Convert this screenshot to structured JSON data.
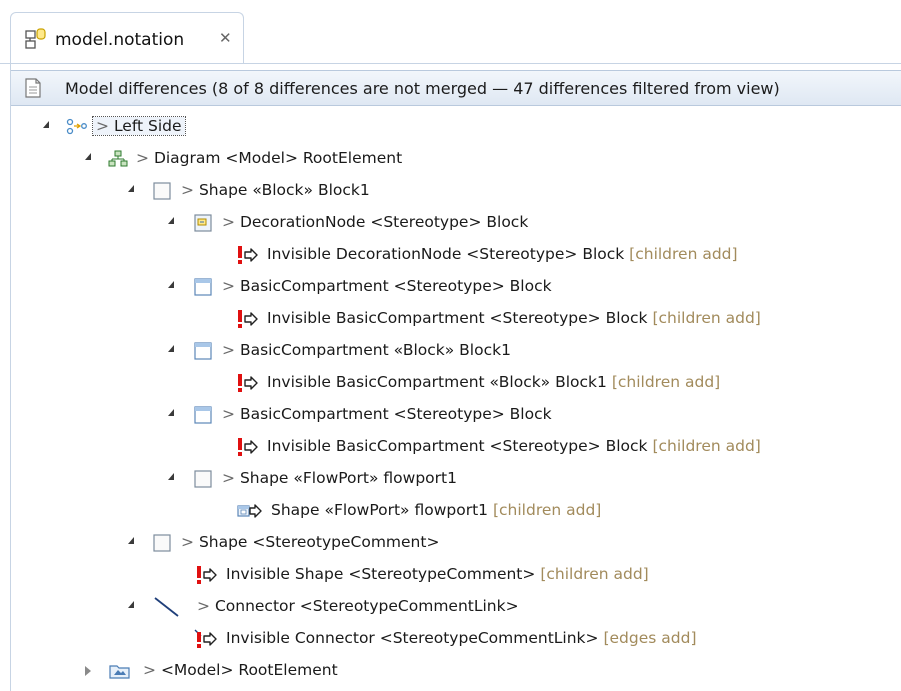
{
  "tab": {
    "title": "model.notation",
    "close_glyph": "✕",
    "icon": "notation-file-icon"
  },
  "header": {
    "text": "Model differences  (8 of 8 differences are not merged — 47 differences filtered from view)",
    "icon": "document-icon"
  },
  "tree": [
    {
      "toggle": "expanded",
      "icon": "comparison-side-icon",
      "chevron": ">",
      "label": "Left Side",
      "annotation": ""
    },
    {
      "toggle": "expanded",
      "icon": "diagram-icon",
      "chevron": ">",
      "label": "Diagram <Model> RootElement",
      "annotation": ""
    },
    {
      "toggle": "expanded",
      "icon": "shape-icon",
      "chevron": ">",
      "label": "Shape «Block» Block1",
      "annotation": ""
    },
    {
      "toggle": "expanded",
      "icon": "decoration-node-icon",
      "chevron": ">",
      "label": "DecorationNode <Stereotype> Block",
      "annotation": ""
    },
    {
      "toggle": "none",
      "icon": "conflict-diff-icon",
      "chevron": "",
      "label": "Invisible DecorationNode <Stereotype> Block",
      "annotation": "[children add]"
    },
    {
      "toggle": "expanded",
      "icon": "compartment-icon",
      "chevron": ">",
      "label": "BasicCompartment <Stereotype> Block",
      "annotation": ""
    },
    {
      "toggle": "none",
      "icon": "conflict-diff-icon",
      "chevron": "",
      "label": "Invisible BasicCompartment <Stereotype> Block",
      "annotation": "[children add]"
    },
    {
      "toggle": "expanded",
      "icon": "compartment-icon",
      "chevron": ">",
      "label": "BasicCompartment «Block» Block1",
      "annotation": ""
    },
    {
      "toggle": "none",
      "icon": "conflict-diff-icon",
      "chevron": "",
      "label": "Invisible BasicCompartment «Block» Block1",
      "annotation": "[children add]"
    },
    {
      "toggle": "expanded",
      "icon": "compartment-icon",
      "chevron": ">",
      "label": "BasicCompartment <Stereotype> Block",
      "annotation": ""
    },
    {
      "toggle": "none",
      "icon": "conflict-diff-icon",
      "chevron": "",
      "label": "Invisible BasicCompartment <Stereotype> Block",
      "annotation": "[children add]"
    },
    {
      "toggle": "expanded",
      "icon": "shape-icon",
      "chevron": ">",
      "label": "Shape «FlowPort» flowport1",
      "annotation": ""
    },
    {
      "toggle": "none",
      "icon": "shape-diff-icon",
      "chevron": "",
      "label": "Shape «FlowPort» flowport1",
      "annotation": "[children add]"
    },
    {
      "toggle": "expanded",
      "icon": "shape-icon",
      "chevron": ">",
      "label": "Shape <StereotypeComment>",
      "annotation": ""
    },
    {
      "toggle": "none",
      "icon": "conflict-diff-icon",
      "chevron": "",
      "label": "Invisible Shape <StereotypeComment>",
      "annotation": "[children add]"
    },
    {
      "toggle": "expanded",
      "icon": "connector-icon",
      "chevron": ">",
      "label": "Connector <StereotypeCommentLink>",
      "annotation": ""
    },
    {
      "toggle": "none",
      "icon": "conflict-diff-icon",
      "chevron": "",
      "label": "Invisible Connector <StereotypeCommentLink>",
      "annotation": "[edges add]"
    },
    {
      "toggle": "collapsed",
      "icon": "model-icon",
      "chevron": ">",
      "label": "<Model> RootElement",
      "annotation": ""
    }
  ],
  "colors": {
    "annotation": "#a28b5c",
    "header_bg": "#dfe8f3",
    "border": "#c7d4e4"
  }
}
